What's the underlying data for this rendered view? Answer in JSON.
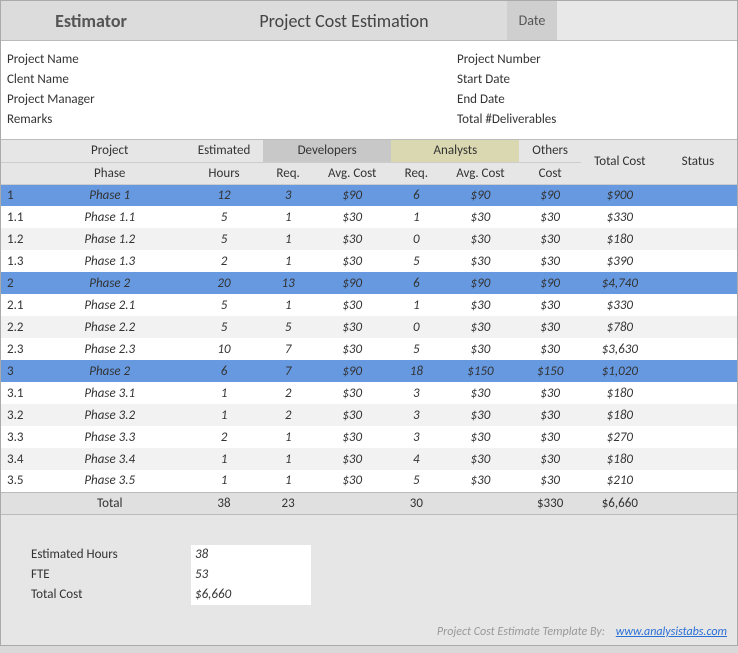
{
  "header": {
    "estimator_label": "Estimator",
    "title": "Project Cost Estimation",
    "date_label": "Date",
    "date_value": ""
  },
  "info": {
    "left_labels": [
      "Project Name",
      "Clent Name",
      "Project Manager",
      "Remarks"
    ],
    "left_values": [
      "",
      "",
      "",
      ""
    ],
    "right_labels": [
      "Project Number",
      "Start Date",
      "End Date",
      "Total #Deliverables"
    ],
    "right_values": [
      "",
      "",
      "",
      ""
    ]
  },
  "columns": {
    "project": "Project",
    "phase": "Phase",
    "est": "Estimated",
    "hours": "Hours",
    "devs": "Developers",
    "anas": "Analysts",
    "req": "Req.",
    "avgcost": "Avg. Cost",
    "others": "Others",
    "others_cost": "Cost",
    "totalcost": "Total Cost",
    "status": "Status"
  },
  "chart_data": {
    "type": "table",
    "title": "Project Cost Estimation",
    "rows": [
      {
        "num": "1",
        "phase": "Phase 1",
        "hours": "12",
        "dev_req": "3",
        "dev_cost": "$90",
        "ana_req": "6",
        "ana_cost": "$90",
        "others": "$90",
        "total": "$900",
        "status": "",
        "major": true
      },
      {
        "num": "1.1",
        "phase": "Phase 1.1",
        "hours": "5",
        "dev_req": "1",
        "dev_cost": "$30",
        "ana_req": "1",
        "ana_cost": "$30",
        "others": "$30",
        "total": "$330",
        "status": "",
        "major": false
      },
      {
        "num": "1.2",
        "phase": "Phase 1.2",
        "hours": "5",
        "dev_req": "1",
        "dev_cost": "$30",
        "ana_req": "0",
        "ana_cost": "$30",
        "others": "$30",
        "total": "$180",
        "status": "",
        "major": false
      },
      {
        "num": "1.3",
        "phase": "Phase 1.3",
        "hours": "2",
        "dev_req": "1",
        "dev_cost": "$30",
        "ana_req": "5",
        "ana_cost": "$30",
        "others": "$30",
        "total": "$390",
        "status": "",
        "major": false
      },
      {
        "num": "2",
        "phase": "Phase 2",
        "hours": "20",
        "dev_req": "13",
        "dev_cost": "$90",
        "ana_req": "6",
        "ana_cost": "$90",
        "others": "$90",
        "total": "$4,740",
        "status": "",
        "major": true
      },
      {
        "num": "2.1",
        "phase": "Phase 2.1",
        "hours": "5",
        "dev_req": "1",
        "dev_cost": "$30",
        "ana_req": "1",
        "ana_cost": "$30",
        "others": "$30",
        "total": "$330",
        "status": "",
        "major": false
      },
      {
        "num": "2.2",
        "phase": "Phase 2.2",
        "hours": "5",
        "dev_req": "5",
        "dev_cost": "$30",
        "ana_req": "0",
        "ana_cost": "$30",
        "others": "$30",
        "total": "$780",
        "status": "",
        "major": false
      },
      {
        "num": "2.3",
        "phase": "Phase 2.3",
        "hours": "10",
        "dev_req": "7",
        "dev_cost": "$30",
        "ana_req": "5",
        "ana_cost": "$30",
        "others": "$30",
        "total": "$3,630",
        "status": "",
        "major": false
      },
      {
        "num": "3",
        "phase": "Phase 2",
        "hours": "6",
        "dev_req": "7",
        "dev_cost": "$90",
        "ana_req": "18",
        "ana_cost": "$150",
        "others": "$150",
        "total": "$1,020",
        "status": "",
        "major": true
      },
      {
        "num": "3.1",
        "phase": "Phase 3.1",
        "hours": "1",
        "dev_req": "2",
        "dev_cost": "$30",
        "ana_req": "3",
        "ana_cost": "$30",
        "others": "$30",
        "total": "$180",
        "status": "",
        "major": false
      },
      {
        "num": "3.2",
        "phase": "Phase 3.2",
        "hours": "1",
        "dev_req": "2",
        "dev_cost": "$30",
        "ana_req": "3",
        "ana_cost": "$30",
        "others": "$30",
        "total": "$180",
        "status": "",
        "major": false
      },
      {
        "num": "3.3",
        "phase": "Phase 3.3",
        "hours": "2",
        "dev_req": "1",
        "dev_cost": "$30",
        "ana_req": "3",
        "ana_cost": "$30",
        "others": "$30",
        "total": "$270",
        "status": "",
        "major": false
      },
      {
        "num": "3.4",
        "phase": "Phase 3.4",
        "hours": "1",
        "dev_req": "1",
        "dev_cost": "$30",
        "ana_req": "4",
        "ana_cost": "$30",
        "others": "$30",
        "total": "$180",
        "status": "",
        "major": false
      },
      {
        "num": "3.5",
        "phase": "Phase 3.5",
        "hours": "1",
        "dev_req": "1",
        "dev_cost": "$30",
        "ana_req": "5",
        "ana_cost": "$30",
        "others": "$30",
        "total": "$210",
        "status": "",
        "major": false
      }
    ],
    "total_row": {
      "label": "Total",
      "hours": "38",
      "dev_req": "23",
      "dev_cost": "",
      "ana_req": "30",
      "ana_cost": "",
      "others": "$330",
      "total": "$6,660",
      "status": ""
    }
  },
  "summary": {
    "est_hours_label": "Estimated Hours",
    "est_hours_value": "38",
    "fte_label": "FTE",
    "fte_value": "53",
    "total_cost_label": "Total Cost",
    "total_cost_value": "$6,660"
  },
  "footer": {
    "text": "Project Cost Estimate Template By:",
    "link_text": "www.analysistabs.com"
  }
}
